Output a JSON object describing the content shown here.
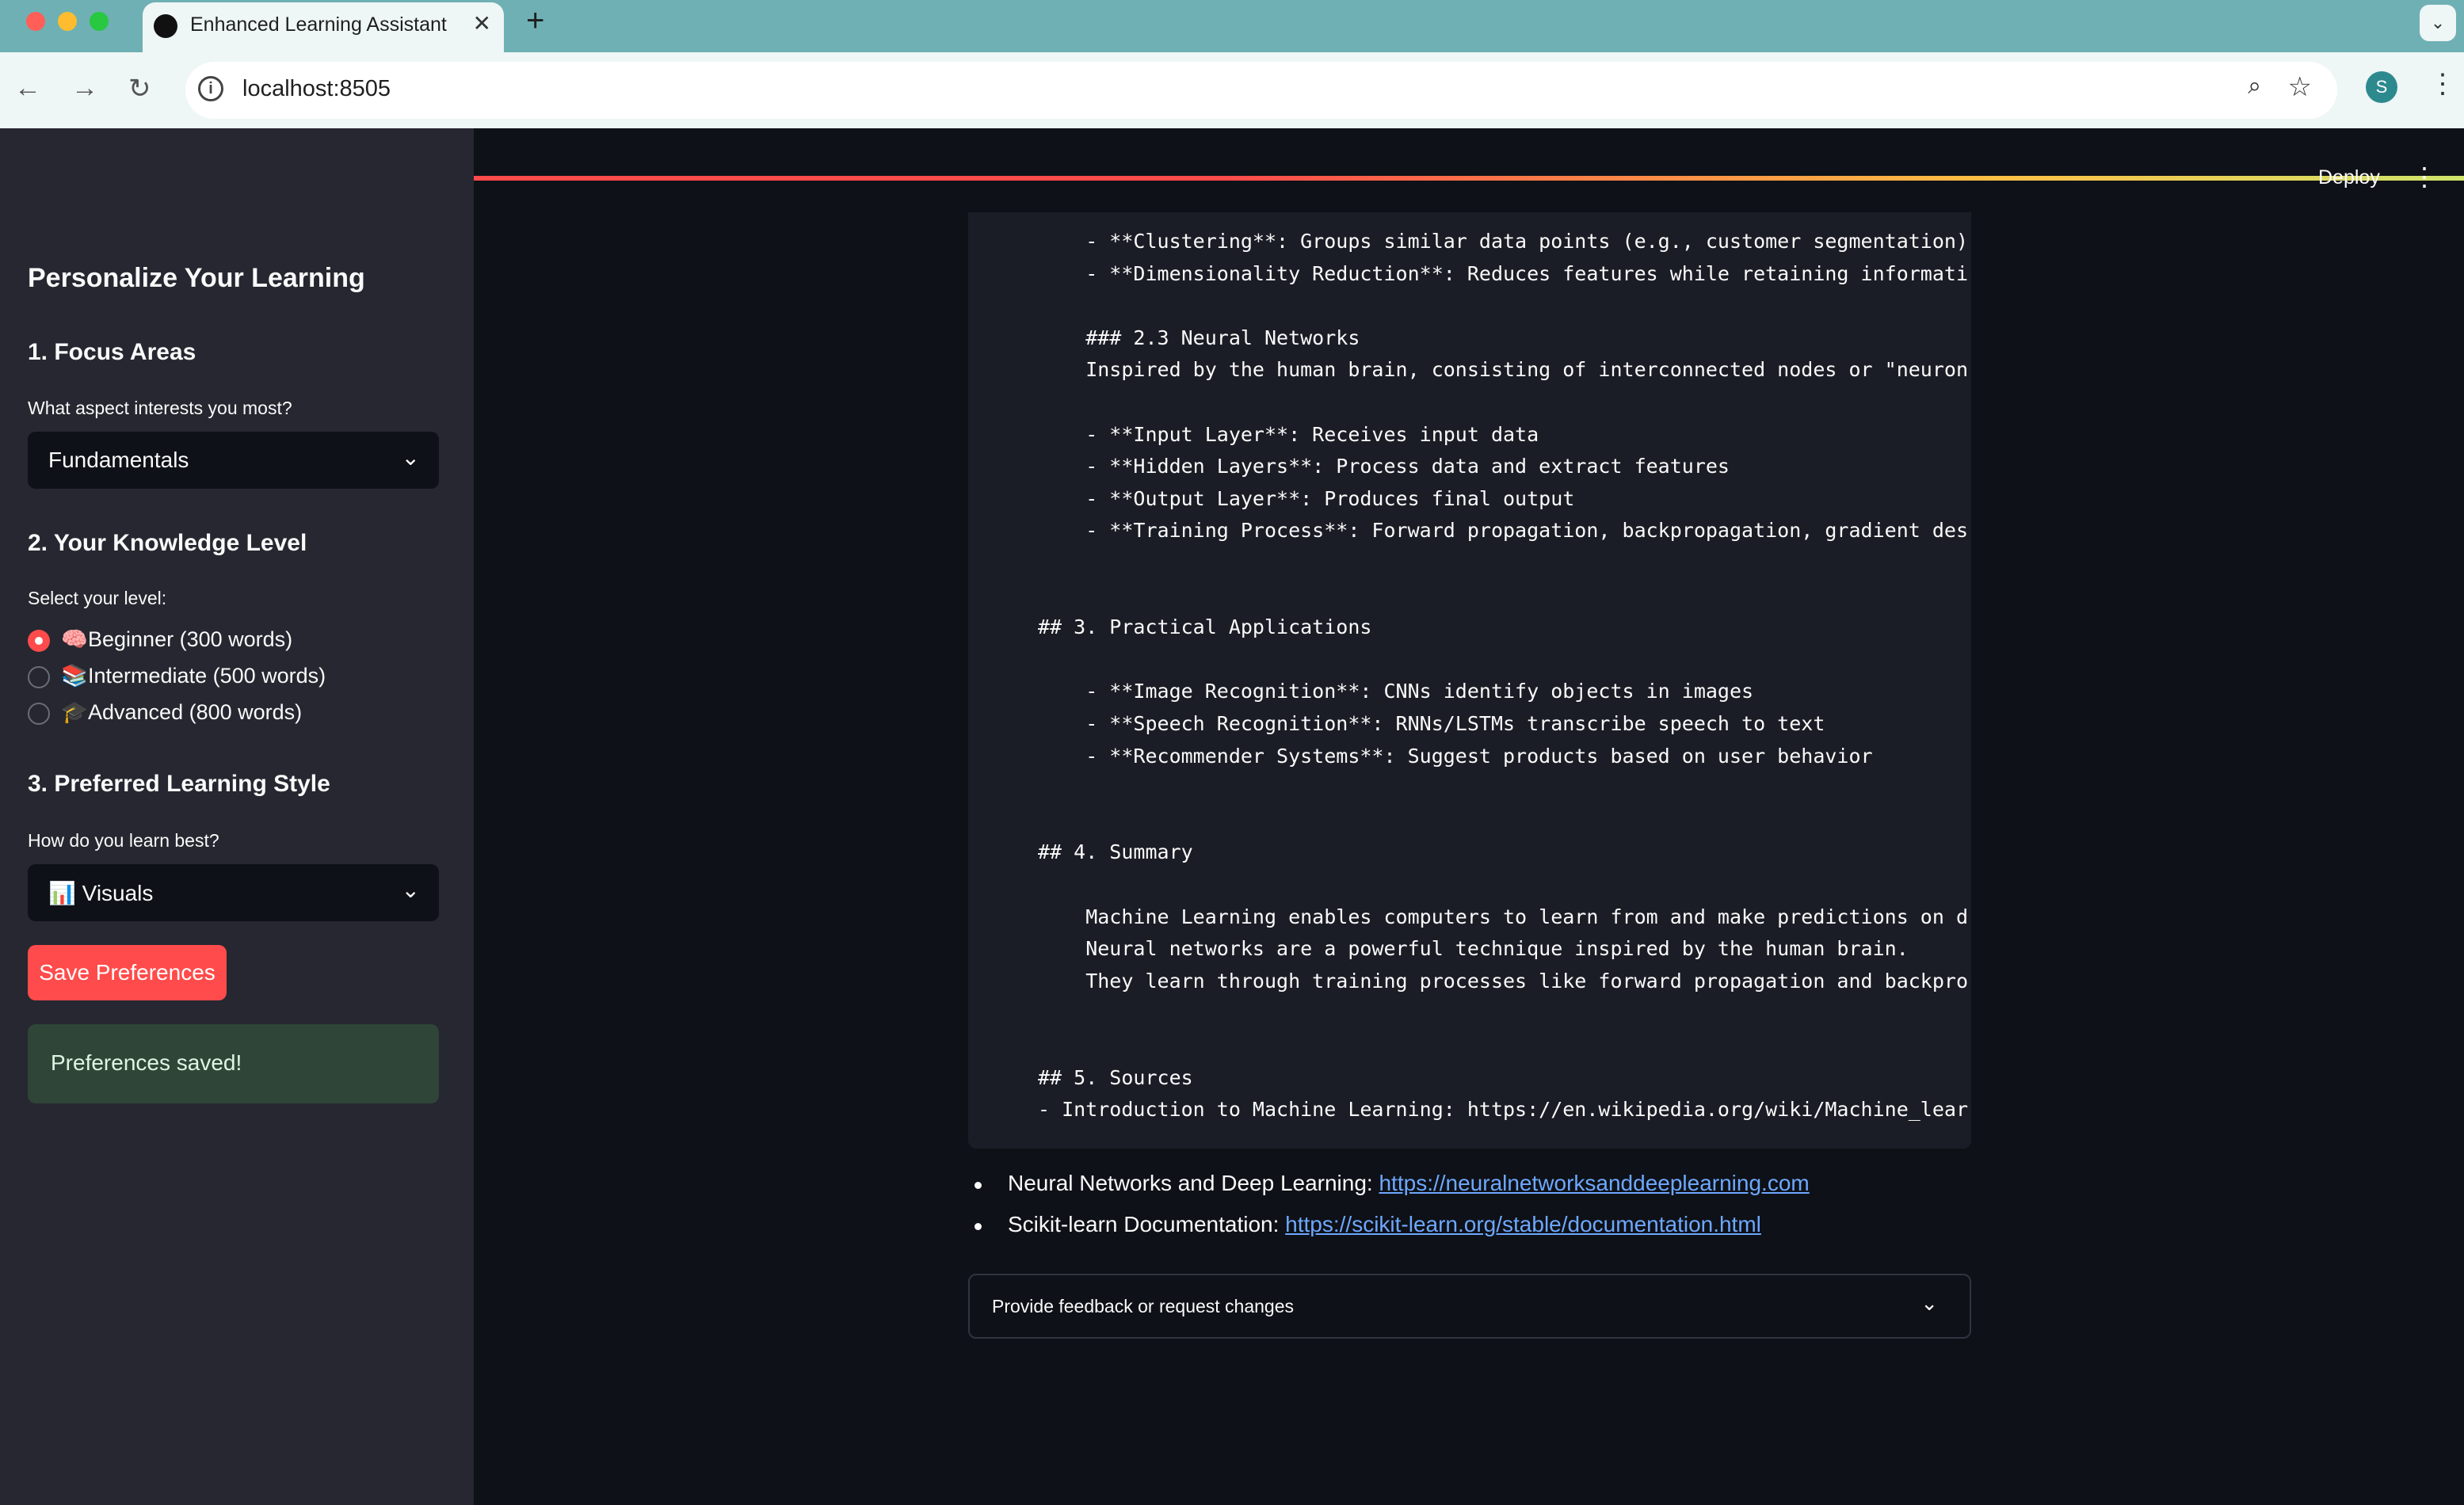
{
  "browser": {
    "tab_title": "Enhanced Learning Assistant",
    "tab_close": "✕",
    "new_tab": "+",
    "tab_search": "⌄",
    "url": "localhost:8505",
    "profile_initial": "S",
    "back_icon": "←",
    "forward_icon": "→",
    "reload_icon": "↻",
    "info_icon": "i",
    "zoom_icon": "⌕",
    "star_icon": "☆",
    "menu_icon": "⋮"
  },
  "sidebar": {
    "title": "Personalize Your Learning",
    "section1": {
      "heading": "1. Focus Areas",
      "label": "What aspect interests you most?",
      "selected": "Fundamentals"
    },
    "section2": {
      "heading": "2. Your Knowledge Level",
      "label": "Select your level:",
      "options": [
        {
          "emoji": "🧠",
          "label": "Beginner (300 words)",
          "selected": true
        },
        {
          "emoji": "📚",
          "label": "Intermediate (500 words)",
          "selected": false
        },
        {
          "emoji": "🎓",
          "label": "Advanced (800 words)",
          "selected": false
        }
      ]
    },
    "section3": {
      "heading": "3. Preferred Learning Style",
      "label": "How do you learn best?",
      "selected": "📊 Visuals"
    },
    "save_button": "Save Preferences",
    "success_message": "Preferences saved!",
    "chevron": "⌄"
  },
  "main": {
    "deploy": "Deploy",
    "menu": "⋮",
    "code_lines": [
      "    - **Clustering**: Groups similar data points (e.g., customer segmentation)",
      "    - **Dimensionality Reduction**: Reduces features while retaining informati",
      "",
      "    ### 2.3 Neural Networks",
      "    Inspired by the human brain, consisting of interconnected nodes or \"neuron",
      "",
      "    - **Input Layer**: Receives input data",
      "    - **Hidden Layers**: Process data and extract features",
      "    - **Output Layer**: Produces final output",
      "    - **Training Process**: Forward propagation, backpropagation, gradient des",
      "",
      "",
      "## 3. Practical Applications",
      "",
      "    - **Image Recognition**: CNNs identify objects in images",
      "    - **Speech Recognition**: RNNs/LSTMs transcribe speech to text",
      "    - **Recommender Systems**: Suggest products based on user behavior",
      "",
      "",
      "## 4. Summary",
      "",
      "    Machine Learning enables computers to learn from and make predictions on d",
      "    Neural networks are a powerful technique inspired by the human brain.",
      "    They learn through training processes like forward propagation and backpro",
      "",
      "",
      "## 5. Sources",
      "- Introduction to Machine Learning: https://en.wikipedia.org/wiki/Machine_lear"
    ],
    "sources": [
      {
        "text": "Neural Networks and Deep Learning: ",
        "url": "https://neuralnetworksanddeeplearning.com"
      },
      {
        "text": "Scikit-learn Documentation: ",
        "url": "https://scikit-learn.org/stable/documentation.html"
      }
    ],
    "feedback_label": "Provide feedback or request changes",
    "feedback_chevron": "⌄"
  }
}
